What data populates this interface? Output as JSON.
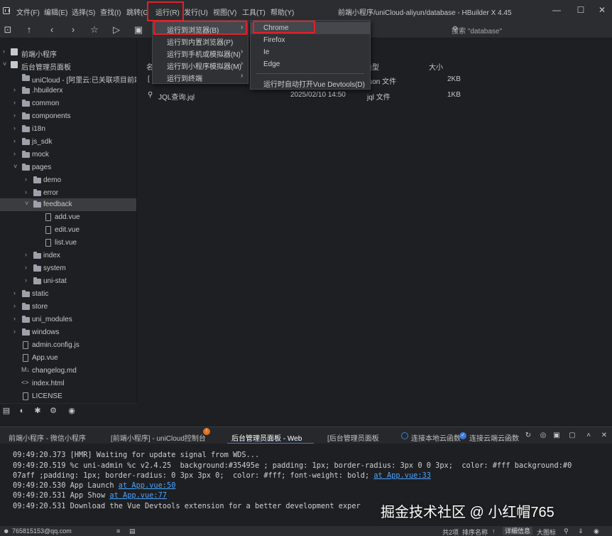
{
  "window": {
    "title": "前端小程序/uniCloud-aliyun/database - HBuilder X 4.45"
  },
  "menubar": {
    "items": [
      "文件(F)",
      "编辑(E)",
      "选择(S)",
      "查找(I)",
      "跳转(G",
      "运行(R)",
      "发行(U)",
      "视图(V)",
      "工具(T)",
      "帮助(Y)"
    ]
  },
  "toolbar": {
    "search_placeholder": "搜索 \"database\""
  },
  "sidebar": {
    "rows": [
      {
        "label": "前端小程序"
      },
      {
        "label": "后台管理员面板"
      },
      {
        "label": "uniCloud - [阿里云:已关联项目前端"
      },
      {
        "label": ".hbuilderx"
      },
      {
        "label": "common"
      },
      {
        "label": "components"
      },
      {
        "label": "i18n"
      },
      {
        "label": "js_sdk"
      },
      {
        "label": "mock"
      },
      {
        "label": "pages"
      },
      {
        "label": "demo"
      },
      {
        "label": "error"
      },
      {
        "label": "feedback"
      },
      {
        "label": "add.vue"
      },
      {
        "label": "edit.vue"
      },
      {
        "label": "list.vue"
      },
      {
        "label": "index"
      },
      {
        "label": "system"
      },
      {
        "label": "uni-stat"
      },
      {
        "label": "static"
      },
      {
        "label": "store"
      },
      {
        "label": "uni_modules"
      },
      {
        "label": "windows"
      },
      {
        "label": "admin.config.js"
      },
      {
        "label": "App.vue"
      },
      {
        "label": "changelog.md"
      },
      {
        "label": "index.html"
      },
      {
        "label": "LICENSE"
      }
    ]
  },
  "file_list": {
    "headers": {
      "name": "名",
      "type": "类型",
      "size": "大小"
    },
    "rows": [
      {
        "name": "[",
        "date": "",
        "type": "json 文件",
        "size": "2KB"
      },
      {
        "name": "JQL查询.jql",
        "date": "2025/02/10 14:50",
        "type": "jql 文件",
        "size": "1KB"
      }
    ]
  },
  "run_menu": {
    "items": [
      {
        "label": "运行到浏览器(B)"
      },
      {
        "label": "运行到内置浏览器(P)"
      },
      {
        "label": "运行到手机或模拟器(N)"
      },
      {
        "label": "运行到小程序模拟器(M)"
      },
      {
        "label": "运行到终端"
      }
    ]
  },
  "browser_menu": {
    "items": [
      {
        "label": "Chrome"
      },
      {
        "label": "Firefox"
      },
      {
        "label": "Ie"
      },
      {
        "label": "Edge"
      }
    ],
    "devtools": "运行时自动打开Vue Devtools(D)"
  },
  "console": {
    "tabs": [
      {
        "label": "前端小程序 - 微信小程序"
      },
      {
        "label": "[前端小程序] - uniCloud控制台"
      },
      {
        "label": "后台管理员面板 - Web"
      },
      {
        "label": "[后台管理员面板"
      }
    ],
    "badge": "!",
    "cloud_local": "连接本地云函数",
    "cloud_remote": "连接云端云函数",
    "lines": [
      {
        "text": "09:49:20.373 [HMR] Waiting for update signal from WDS...",
        "link": ""
      },
      {
        "text": "09:49:20.519 %c uni-admin %c v2.4.25  background:#35495e ; padding: 1px; border-radius: 3px 0 0 3px;  color: #fff background:#0",
        "link": ""
      },
      {
        "text": "07aff ;padding: 1px; border-radius: 0 3px 3px 0;  color: #fff; font-weight: bold; ",
        "link": "at App.vue:33"
      },
      {
        "text": "09:49:20.530 App Launch ",
        "link": "at App.vue:50"
      },
      {
        "text": "09:49:20.531 App Show ",
        "link": "at App.vue:77"
      },
      {
        "text": "09:49:20.531 Download the Vue Devtools extension for a better development exper",
        "link": ""
      }
    ]
  },
  "watermark": "掘金技术社区 @ 小红帽765",
  "statusbar": {
    "user": "765815153@qq.com",
    "lines_info": "共2项",
    "sort": "排序名称",
    "detail": "详细信息",
    "large_icon": "大图标"
  },
  "colors": {
    "highlight_box": "#e0202a",
    "link": "#4aa3ff",
    "active_underline": "#3b7bd8"
  }
}
